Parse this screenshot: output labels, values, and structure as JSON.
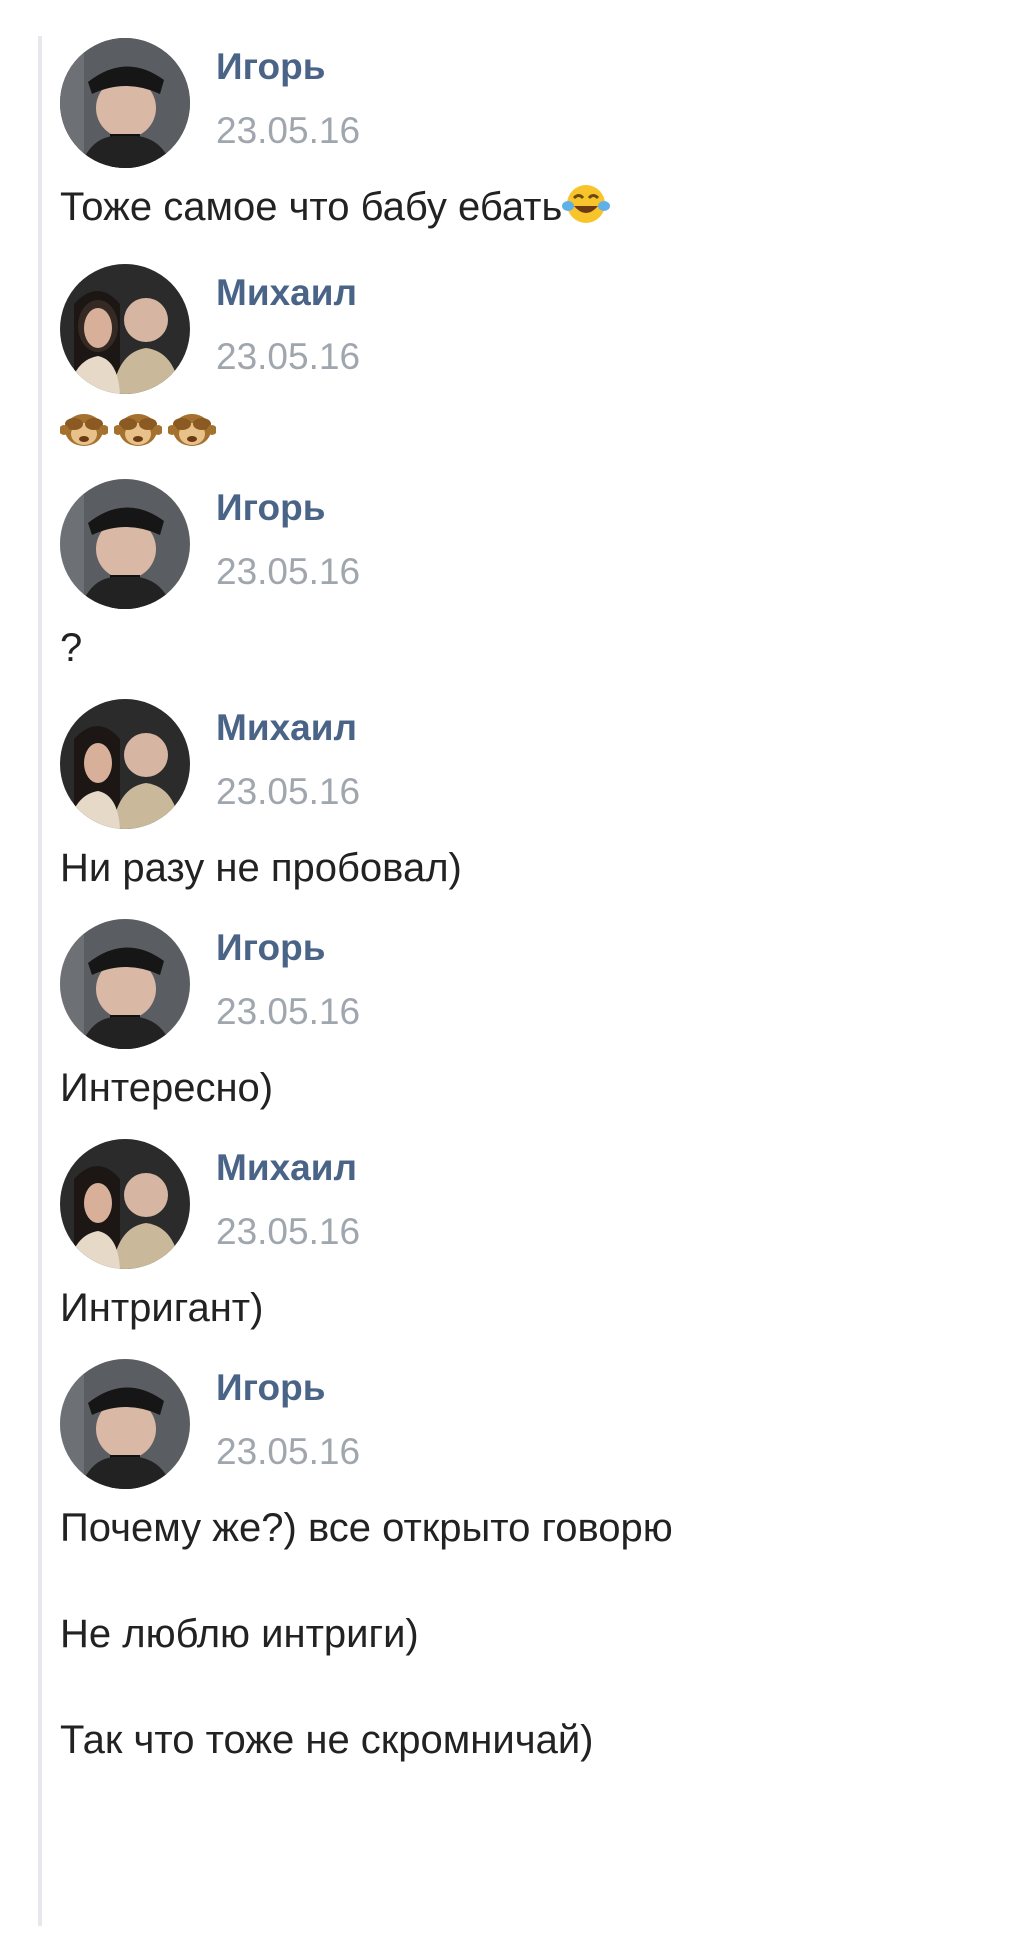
{
  "messages": [
    {
      "author": "Игорь",
      "date": "23.05.16",
      "avatar": "avatar-igor",
      "lines": [
        "Тоже самое что бабу ебать"
      ],
      "trailing_emoji": "face-with-tears-of-joy"
    },
    {
      "author": "Михаил",
      "date": "23.05.16",
      "avatar": "avatar-mikhail",
      "lines": [],
      "emojis": [
        "see-no-evil-monkey",
        "see-no-evil-monkey",
        "see-no-evil-monkey"
      ]
    },
    {
      "author": "Игорь",
      "date": "23.05.16",
      "avatar": "avatar-igor",
      "lines": [
        "?"
      ]
    },
    {
      "author": "Михаил",
      "date": "23.05.16",
      "avatar": "avatar-mikhail",
      "lines": [
        "Ни разу не пробовал)"
      ]
    },
    {
      "author": "Игорь",
      "date": "23.05.16",
      "avatar": "avatar-igor",
      "lines": [
        "Интересно)"
      ]
    },
    {
      "author": "Михаил",
      "date": "23.05.16",
      "avatar": "avatar-mikhail",
      "lines": [
        "Интригант)"
      ]
    },
    {
      "author": "Игорь",
      "date": "23.05.16",
      "avatar": "avatar-igor",
      "lines": [
        "Почему же?) все открыто говорю",
        "Не люблю интриги)",
        "Так что тоже не скромничай)"
      ]
    }
  ]
}
